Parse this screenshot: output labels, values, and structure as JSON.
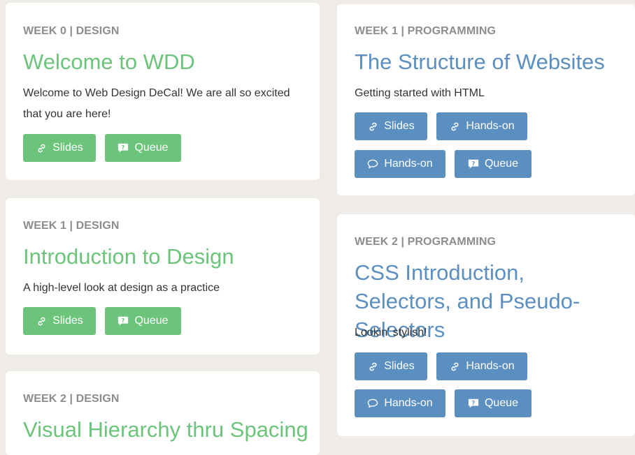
{
  "colors": {
    "design_accent": "#6cc47b",
    "programming_accent": "#5b8fc0",
    "background": "#efece7",
    "kicker": "#8d8d8d"
  },
  "design_column": [
    {
      "kicker": "WEEK 0 | DESIGN",
      "title": "Welcome to WDD",
      "description": "Welcome to Web Design DeCal! We are all so excited that you are here!",
      "buttons": [
        {
          "label": "Slides",
          "icon": "link-icon"
        },
        {
          "label": "Queue",
          "icon": "question-bubble-icon"
        }
      ]
    },
    {
      "kicker": "WEEK 1 | DESIGN",
      "title": "Introduction to Design",
      "description": "A high-level look at design as a practice",
      "buttons": [
        {
          "label": "Slides",
          "icon": "link-icon"
        },
        {
          "label": "Queue",
          "icon": "question-bubble-icon"
        }
      ]
    },
    {
      "kicker": "WEEK 2 | DESIGN",
      "title": "Visual Hierarchy thru Spacing"
    }
  ],
  "programming_column": [
    {
      "kicker": "WEEK 1 | PROGRAMMING",
      "title": "The Structure of Websites",
      "description": "Getting started with HTML",
      "buttons": [
        {
          "label": "Slides",
          "icon": "link-icon"
        },
        {
          "label": "Hands-on",
          "icon": "link-icon"
        },
        {
          "label": "Hands-on",
          "icon": "speech-bubble-icon"
        },
        {
          "label": "Queue",
          "icon": "question-bubble-icon"
        }
      ]
    },
    {
      "kicker": "WEEK 2 | PROGRAMMING",
      "title": "CSS Introduction, Selectors, and Pseudo-Selectors",
      "description": "Lookin' stylish!",
      "buttons": [
        {
          "label": "Slides",
          "icon": "link-icon"
        },
        {
          "label": "Hands-on",
          "icon": "link-icon"
        },
        {
          "label": "Hands-on",
          "icon": "speech-bubble-icon"
        },
        {
          "label": "Queue",
          "icon": "question-bubble-icon"
        }
      ]
    }
  ]
}
